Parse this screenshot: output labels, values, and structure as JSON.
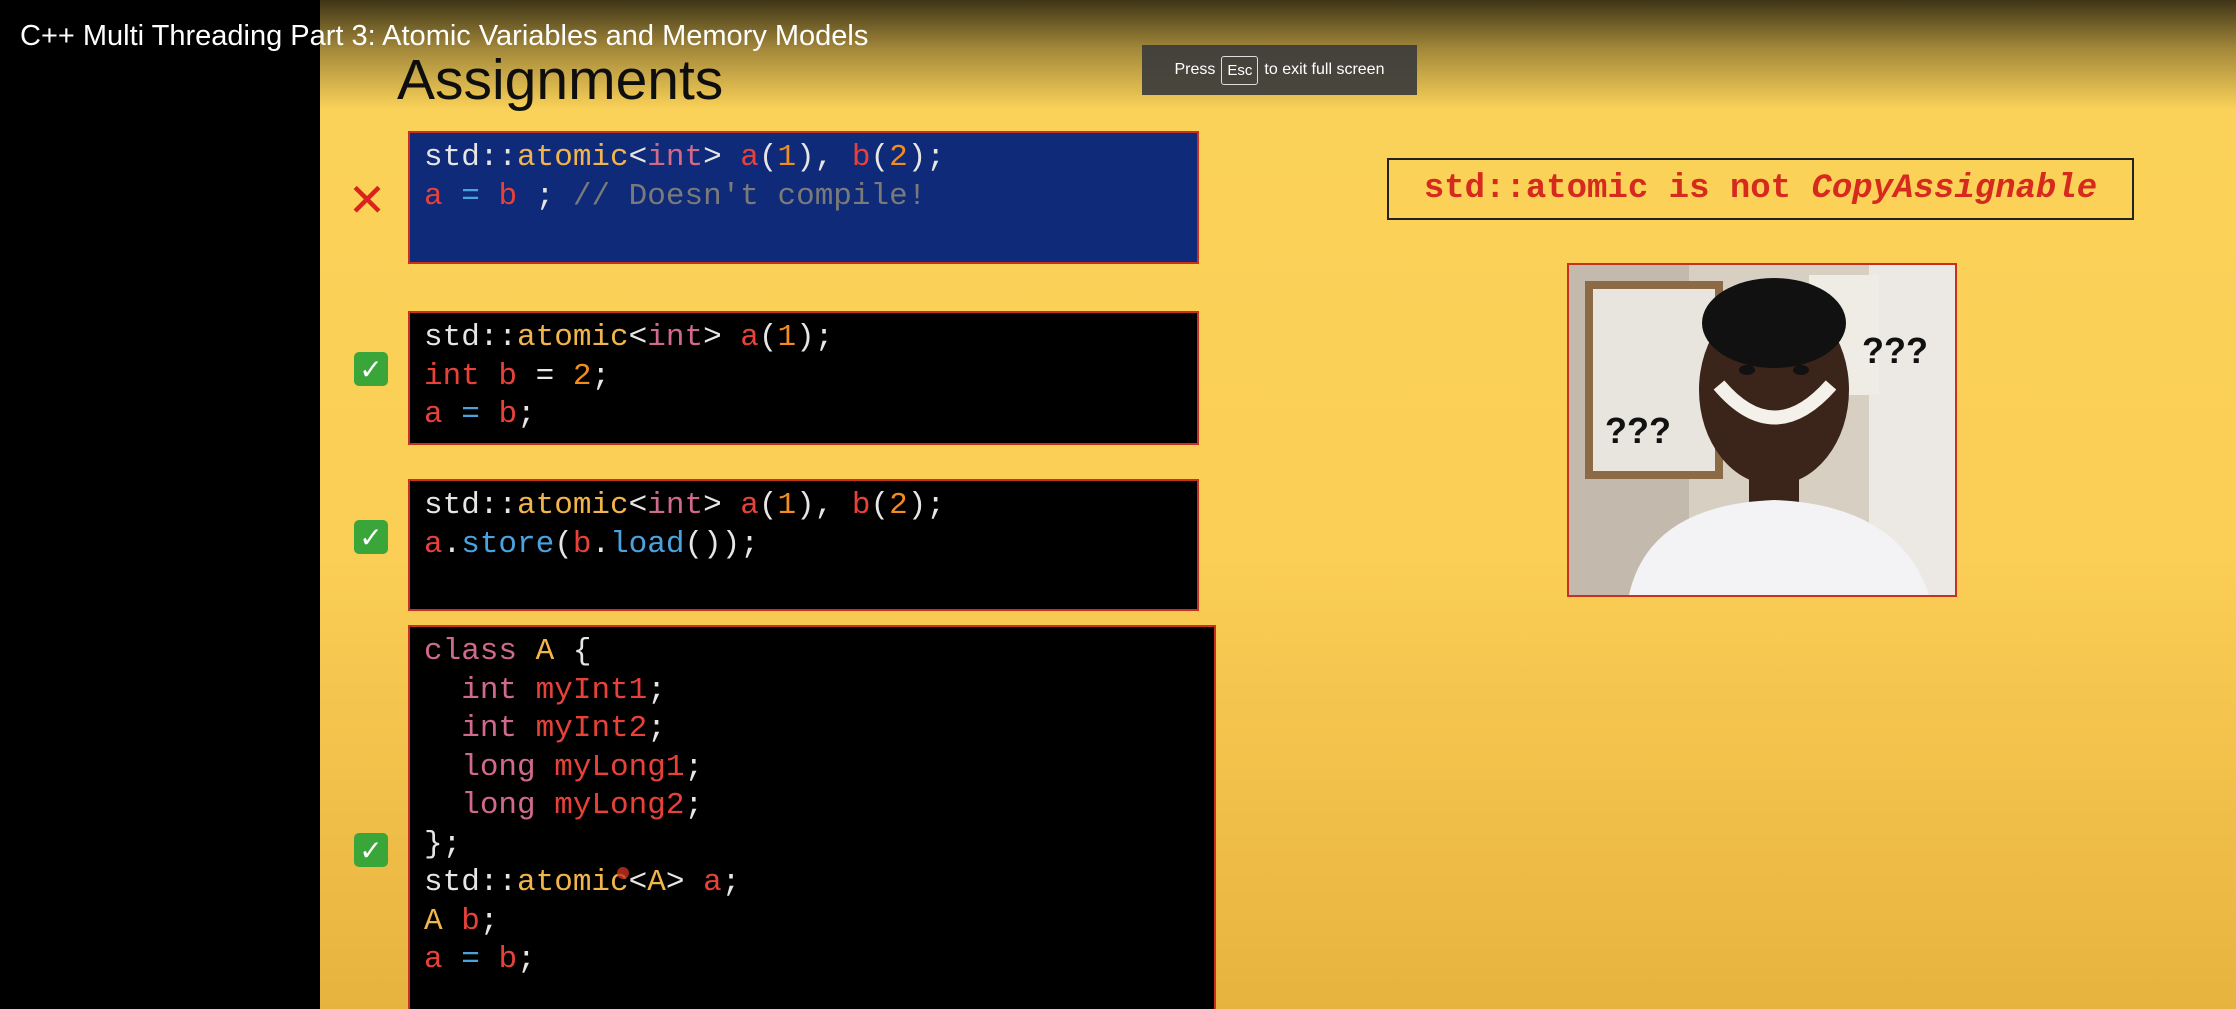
{
  "video": {
    "title": "C++ Multi Threading Part 3: Atomic Variables and Memory Models"
  },
  "fullscreen_notice": {
    "prefix": "Press",
    "key": "Esc",
    "suffix": "to exit full screen"
  },
  "slide": {
    "title": "Assignments",
    "callout": {
      "text": "std::atomic is not ",
      "emphasis": "CopyAssignable"
    },
    "meme_caption_left": "???",
    "meme_caption_right": "???",
    "colors": {
      "background": "#fbd35a",
      "code_bg": "#000000",
      "code_bg_error": "#0e2a78",
      "border": "#c8311f",
      "check": "#3aa63a",
      "cross": "#d9231b"
    },
    "examples": [
      {
        "status": "error",
        "status_icon": "cross-icon",
        "lines": [
          [
            [
              "plain",
              "std::"
            ],
            [
              "type",
              "atomic"
            ],
            [
              "plain",
              "<"
            ],
            [
              "kw",
              "int"
            ],
            [
              "plain",
              "> "
            ],
            [
              "var",
              "a"
            ],
            [
              "plain",
              "("
            ],
            [
              "num",
              "1"
            ],
            [
              "plain",
              "), "
            ],
            [
              "var",
              "b"
            ],
            [
              "plain",
              "("
            ],
            [
              "num",
              "2"
            ],
            [
              "plain",
              ");"
            ]
          ],
          [
            [
              "var",
              "a"
            ],
            [
              "plain",
              " "
            ],
            [
              "fn",
              "="
            ],
            [
              "plain",
              " "
            ],
            [
              "var",
              "b"
            ],
            [
              "plain",
              " ; "
            ],
            [
              "cmt",
              "// Doesn't compile!"
            ]
          ]
        ]
      },
      {
        "status": "ok",
        "status_icon": "check-icon",
        "lines": [
          [
            [
              "plain",
              "std::"
            ],
            [
              "type",
              "atomic"
            ],
            [
              "plain",
              "<"
            ],
            [
              "kw",
              "int"
            ],
            [
              "plain",
              "> "
            ],
            [
              "var",
              "a"
            ],
            [
              "plain",
              "("
            ],
            [
              "num",
              "1"
            ],
            [
              "plain",
              ");"
            ]
          ],
          [
            [
              "var",
              "int"
            ],
            [
              "plain",
              " "
            ],
            [
              "var",
              "b"
            ],
            [
              "plain",
              " = "
            ],
            [
              "num",
              "2"
            ],
            [
              "plain",
              ";"
            ]
          ],
          [
            [
              "var",
              "a"
            ],
            [
              "plain",
              " "
            ],
            [
              "fn",
              "="
            ],
            [
              "plain",
              " "
            ],
            [
              "var",
              "b"
            ],
            [
              "plain",
              ";"
            ]
          ]
        ]
      },
      {
        "status": "ok",
        "status_icon": "check-icon",
        "lines": [
          [
            [
              "plain",
              "std::"
            ],
            [
              "type",
              "atomic"
            ],
            [
              "plain",
              "<"
            ],
            [
              "kw",
              "int"
            ],
            [
              "plain",
              "> "
            ],
            [
              "var",
              "a"
            ],
            [
              "plain",
              "("
            ],
            [
              "num",
              "1"
            ],
            [
              "plain",
              "), "
            ],
            [
              "var",
              "b"
            ],
            [
              "plain",
              "("
            ],
            [
              "num",
              "2"
            ],
            [
              "plain",
              ");"
            ]
          ],
          [
            [
              "var",
              "a"
            ],
            [
              "plain",
              "."
            ],
            [
              "fn",
              "store"
            ],
            [
              "plain",
              "("
            ],
            [
              "var",
              "b"
            ],
            [
              "plain",
              "."
            ],
            [
              "fn",
              "load"
            ],
            [
              "plain",
              "());"
            ]
          ]
        ]
      },
      {
        "status": "ok",
        "status_icon": "check-icon",
        "lines": [
          [
            [
              "kw",
              "class"
            ],
            [
              "plain",
              " "
            ],
            [
              "type",
              "A"
            ],
            [
              "plain",
              " {"
            ]
          ],
          [
            [
              "plain",
              "  "
            ],
            [
              "kw",
              "int"
            ],
            [
              "plain",
              " "
            ],
            [
              "var",
              "myInt1"
            ],
            [
              "plain",
              ";"
            ]
          ],
          [
            [
              "plain",
              "  "
            ],
            [
              "kw",
              "int"
            ],
            [
              "plain",
              " "
            ],
            [
              "var",
              "myInt2"
            ],
            [
              "plain",
              ";"
            ]
          ],
          [
            [
              "plain",
              "  "
            ],
            [
              "kw",
              "long"
            ],
            [
              "plain",
              " "
            ],
            [
              "var",
              "myLong1"
            ],
            [
              "plain",
              ";"
            ]
          ],
          [
            [
              "plain",
              "  "
            ],
            [
              "kw",
              "long"
            ],
            [
              "plain",
              " "
            ],
            [
              "var",
              "myLong2"
            ],
            [
              "plain",
              ";"
            ]
          ],
          [
            [
              "plain",
              "};"
            ]
          ],
          [
            [
              "plain",
              "std::"
            ],
            [
              "type",
              "atomic"
            ],
            [
              "plain",
              "<"
            ],
            [
              "type",
              "A"
            ],
            [
              "plain",
              "> "
            ],
            [
              "var",
              "a"
            ],
            [
              "plain",
              ";"
            ]
          ],
          [
            [
              "type",
              "A"
            ],
            [
              "plain",
              " "
            ],
            [
              "var",
              "b"
            ],
            [
              "plain",
              ";"
            ]
          ],
          [
            [
              "var",
              "a"
            ],
            [
              "plain",
              " "
            ],
            [
              "fn",
              "="
            ],
            [
              "plain",
              " "
            ],
            [
              "var",
              "b"
            ],
            [
              "plain",
              ";"
            ]
          ]
        ]
      }
    ]
  }
}
